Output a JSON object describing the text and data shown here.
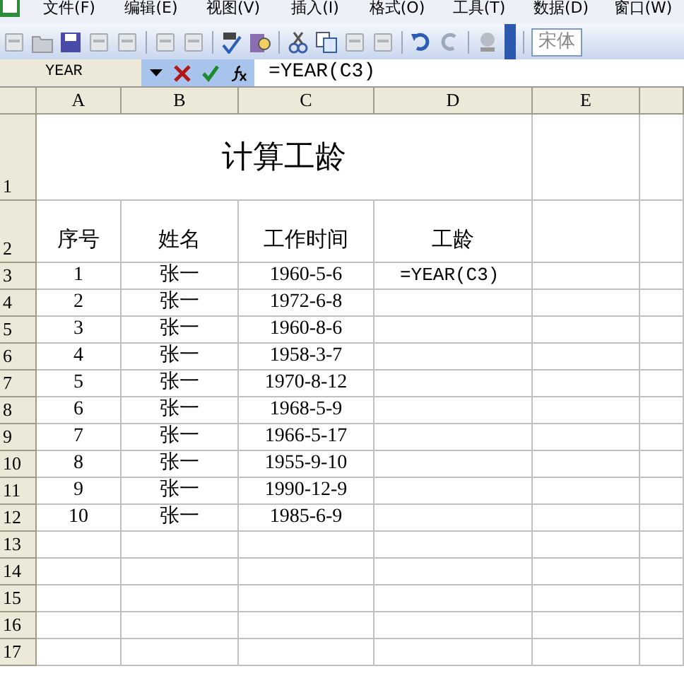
{
  "menu": [
    "文件(F)",
    "编辑(E)",
    "视图(V)",
    "插入(I)",
    "格式(O)",
    "工具(T)",
    "数据(D)",
    "窗口(W)"
  ],
  "font_box": {
    "value": "宋体"
  },
  "formula_bar": {
    "name_box": "YEAR",
    "formula": "=YEAR(C3)"
  },
  "columns": [
    "A",
    "B",
    "C",
    "D",
    "E"
  ],
  "rows": [
    {
      "number": "1",
      "kind": "title",
      "title": "计算工龄"
    },
    {
      "number": "2",
      "kind": "header",
      "cells": [
        "序号",
        "姓名",
        "工作时间",
        "工龄"
      ]
    },
    {
      "number": "3",
      "kind": "data",
      "cells": [
        "1",
        "张一",
        "1960-5-6"
      ],
      "editing": "=YEAR(C3)"
    },
    {
      "number": "4",
      "kind": "data",
      "cells": [
        "2",
        "张一",
        "1972-6-8"
      ]
    },
    {
      "number": "5",
      "kind": "data",
      "cells": [
        "3",
        "张一",
        "1960-8-6"
      ]
    },
    {
      "number": "6",
      "kind": "data",
      "cells": [
        "4",
        "张一",
        "1958-3-7"
      ]
    },
    {
      "number": "7",
      "kind": "data",
      "cells": [
        "5",
        "张一",
        "1970-8-12"
      ]
    },
    {
      "number": "8",
      "kind": "data",
      "cells": [
        "6",
        "张一",
        "1968-5-9"
      ]
    },
    {
      "number": "9",
      "kind": "data",
      "cells": [
        "7",
        "张一",
        "1966-5-17"
      ]
    },
    {
      "number": "10",
      "kind": "data",
      "cells": [
        "8",
        "张一",
        "1955-9-10"
      ]
    },
    {
      "number": "11",
      "kind": "data",
      "cells": [
        "9",
        "张一",
        "1990-12-9"
      ]
    },
    {
      "number": "12",
      "kind": "data",
      "cells": [
        "10",
        "张一",
        "1985-6-9"
      ]
    },
    {
      "number": "13",
      "kind": "empty"
    },
    {
      "number": "14",
      "kind": "empty"
    },
    {
      "number": "15",
      "kind": "empty"
    },
    {
      "number": "16",
      "kind": "empty"
    },
    {
      "number": "17",
      "kind": "empty"
    }
  ]
}
